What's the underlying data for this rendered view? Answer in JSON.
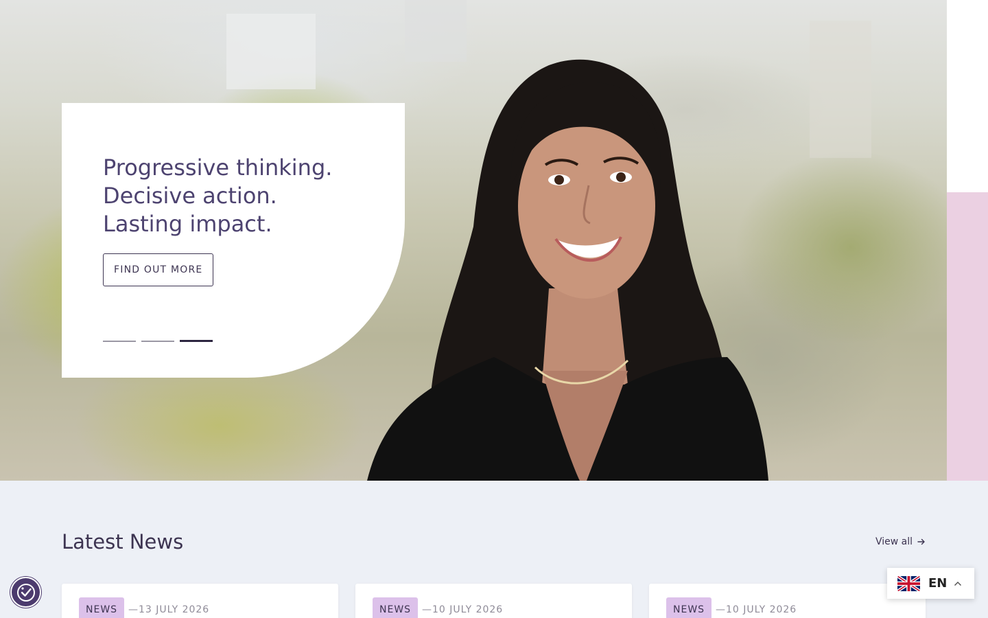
{
  "hero": {
    "heading_lines": [
      "Progressive thinking.",
      "Decisive action.",
      "Lasting impact."
    ],
    "cta_label": "FIND OUT MORE",
    "slides": {
      "count": 3,
      "active": 3
    }
  },
  "news": {
    "heading": "Latest News",
    "view_all_label": "View all",
    "cards": [
      {
        "tag": "NEWS",
        "date": "—13 JULY 2026"
      },
      {
        "tag": "NEWS",
        "date": "—10 JULY 2026"
      },
      {
        "tag": "NEWS",
        "date": "—10 JULY 2026"
      }
    ]
  },
  "language": {
    "code": "EN",
    "flag_icon": "uk-flag-icon"
  },
  "accessibility": {
    "icon": "accessibility-icon"
  },
  "colors": {
    "brand_purple": "#4d4370",
    "accent_pink": "#ebd0e2",
    "tag_lilac": "#dcc1ea",
    "page_bg": "#edf0f6"
  }
}
